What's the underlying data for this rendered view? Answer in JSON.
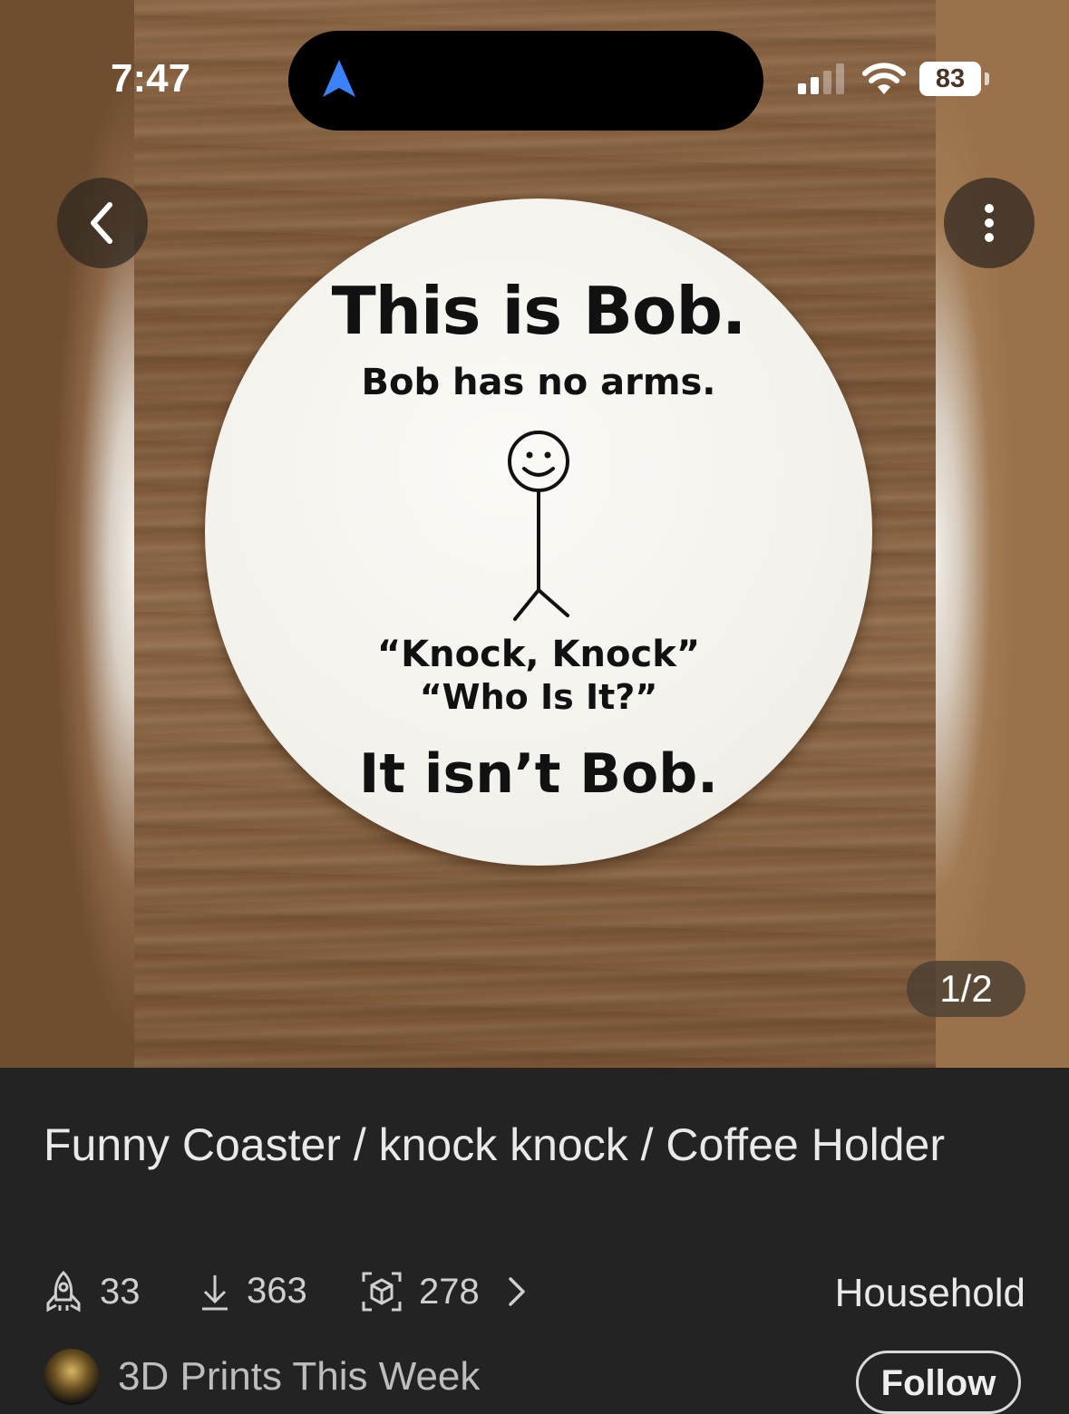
{
  "status_bar": {
    "time": "7:47",
    "battery": "83"
  },
  "gallery": {
    "page_indicator": "1/2",
    "coaster_text": {
      "line1": "This is Bob.",
      "line2": "Bob has no arms.",
      "line3": "“Knock, Knock”",
      "line4": "“Who Is It?”",
      "line5": "It isn’t Bob."
    }
  },
  "header": {
    "back_icon": "chevron-left-icon",
    "more_icon": "vertical-dots-icon"
  },
  "model": {
    "title": "Funny Coaster / knock knock / Coffee Holder",
    "boosts": "33",
    "downloads": "363",
    "prints": "278",
    "category": "Household"
  },
  "creator": {
    "name": "3D Prints This Week",
    "follow_label": "Follow"
  },
  "colors": {
    "background": "#232323",
    "title_text": "#e9e9e9",
    "nav_arrow": "#3a82f7"
  }
}
